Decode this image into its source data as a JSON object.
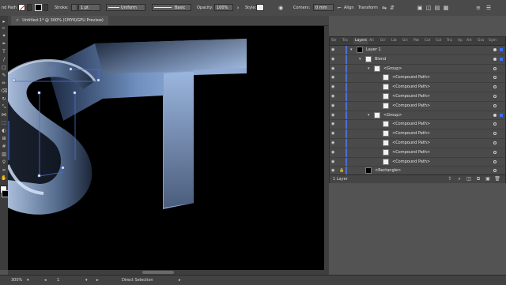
{
  "control_bar": {
    "selection_label": "nd Path",
    "stroke_label": "Stroke:",
    "stroke_weight": "1 pt",
    "profile_label": "Uniform",
    "brush_label": "Basic",
    "opacity_label": "Opacity:",
    "opacity_value": "100%",
    "style_label": "Style:",
    "corners_label": "Corners:",
    "corners_value": "0 mm",
    "align_label": "Align",
    "transform_label": "Transform"
  },
  "document_tab": {
    "close_glyph": "×",
    "title": "Untitled-1* @ 300% (CMYK/GPU Preview)"
  },
  "panel": {
    "tabs": [
      "Str",
      "Tra",
      "Layers",
      "Ali",
      "Gri",
      "Lib",
      "Gri",
      "Pat",
      "Col",
      "Col",
      "Tra",
      "Ap",
      "Art",
      "Gra",
      "Sym"
    ],
    "active_tab": "Layers",
    "rows": [
      {
        "indent": 0,
        "expanded": true,
        "name": "Layer 1",
        "thumb": "dark",
        "target": "filled",
        "selected": true
      },
      {
        "indent": 1,
        "expanded": true,
        "name": "Blend",
        "thumb": "light",
        "target": "filled",
        "selected": true
      },
      {
        "indent": 2,
        "expanded": true,
        "name": "<Group>",
        "thumb": "light",
        "target": "empty",
        "selected": false
      },
      {
        "indent": 3,
        "expanded": null,
        "name": "<Compound Path>",
        "thumb": "light",
        "target": "empty",
        "selected": false
      },
      {
        "indent": 3,
        "expanded": null,
        "name": "<Compound Path>",
        "thumb": "light",
        "target": "empty",
        "selected": false
      },
      {
        "indent": 3,
        "expanded": null,
        "name": "<Compound Path>",
        "thumb": "light",
        "target": "empty",
        "selected": false
      },
      {
        "indent": 3,
        "expanded": null,
        "name": "<Compound Path>",
        "thumb": "light",
        "target": "empty",
        "selected": false
      },
      {
        "indent": 2,
        "expanded": true,
        "name": "<Group>",
        "thumb": "light",
        "target": "filled",
        "selected": true
      },
      {
        "indent": 3,
        "expanded": null,
        "name": "<Compound Path>",
        "thumb": "light",
        "target": "empty",
        "selected": false
      },
      {
        "indent": 3,
        "expanded": null,
        "name": "<Compound Path>",
        "thumb": "light",
        "target": "empty",
        "selected": false
      },
      {
        "indent": 3,
        "expanded": null,
        "name": "<Compound Path>",
        "thumb": "light",
        "target": "empty",
        "selected": false
      },
      {
        "indent": 3,
        "expanded": null,
        "name": "<Compound Path>",
        "thumb": "light",
        "target": "empty",
        "selected": false
      },
      {
        "indent": 3,
        "expanded": null,
        "name": "<Compound Path>",
        "thumb": "light",
        "target": "empty",
        "selected": false
      },
      {
        "indent": 1,
        "expanded": null,
        "name": "<Rectangle>",
        "thumb": "dark",
        "target": "empty",
        "selected": false,
        "locked": true
      }
    ],
    "footer_layer_count": "1 Layer"
  },
  "status_bar": {
    "zoom": "300%",
    "artboard_number": "1",
    "tool_name": "Direct Selection"
  },
  "colors": {
    "accent": "#4f6fcf",
    "selection": "#3d6fff",
    "letter_front": "#a9c4e8",
    "letter_side": "#5d7394",
    "canvas": "#000000"
  },
  "icons": {
    "eye": "eye-icon",
    "lock": "lock-icon",
    "twirl": "chevron-down-icon"
  }
}
